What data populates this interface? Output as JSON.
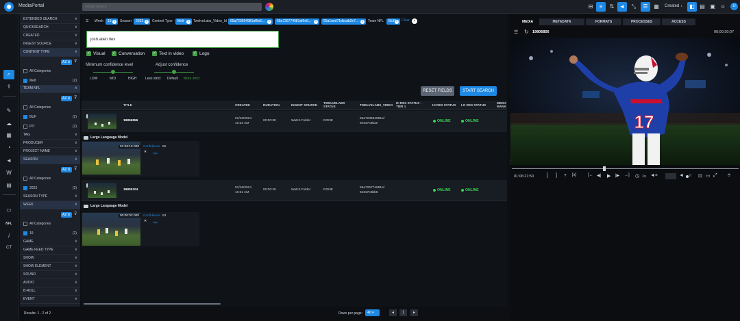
{
  "app": {
    "title": "MediaPortal",
    "search_placeholder": "Global Search",
    "sort_label": "Created",
    "avatar_letter": "U"
  },
  "filters": {
    "rows": [
      {
        "label": "EXTENDED SEARCH",
        "chev": "∨"
      },
      {
        "label": "QUICKSEARCH",
        "chev": "∨"
      },
      {
        "label": "CREATED",
        "chev": "∨"
      },
      {
        "label": "INGEST SOURCE",
        "chev": "∨"
      },
      {
        "label": "CONTENT TYPE",
        "chev": "∧"
      }
    ],
    "content_type": {
      "sort": "AZ ⬇",
      "all": "All Categories",
      "item": "Melt",
      "count": "(2)"
    },
    "team_nfl": {
      "label": "TEAM NFL",
      "sort": "AZ ⬇",
      "all": "All Categories",
      "items": [
        {
          "label": "BUF",
          "count": "(2)"
        },
        {
          "label": "PIT",
          "count": "(2)"
        }
      ]
    },
    "rows2": [
      {
        "label": "TAG",
        "chev": "∨"
      },
      {
        "label": "PRODUCER",
        "chev": "∨"
      },
      {
        "label": "PROJECT NAME",
        "chev": "∨"
      },
      {
        "label": "SEASON",
        "chev": "∧"
      }
    ],
    "season": {
      "sort": "AZ ⬇",
      "all": "All Categories",
      "item": "2023",
      "count": "(2)"
    },
    "rows3": [
      {
        "label": "SEASON TYPE",
        "chev": "∨"
      },
      {
        "label": "WEEK",
        "chev": "∧"
      }
    ],
    "week": {
      "sort": "AZ ⬇",
      "all": "All Categories",
      "item": "19",
      "count": "(2)"
    },
    "rows4": [
      {
        "label": "GAME",
        "chev": "∨"
      },
      {
        "label": "GAME FEED TYPE",
        "chev": "∨"
      },
      {
        "label": "SHOW",
        "chev": "∨"
      },
      {
        "label": "SHOW ELEMENT",
        "chev": "∨"
      },
      {
        "label": "SOUND",
        "chev": "∨"
      },
      {
        "label": "AUDIO",
        "chev": "∨"
      },
      {
        "label": "B-ROLL",
        "chev": "∨"
      },
      {
        "label": "EVENT",
        "chev": "∨"
      }
    ],
    "results": "Results: 1 - 2 of 2"
  },
  "chips": [
    {
      "label": "Week",
      "value": "19"
    },
    {
      "label": "Season",
      "value": "2023"
    },
    {
      "label": "Content Type",
      "value": "Melt"
    },
    {
      "label": "TwelveLabs_Video_Id",
      "value": "65a723664981af6e6..."
    },
    {
      "label": "",
      "value": "65a726774981af6e6..."
    },
    {
      "label": "",
      "value": "65a1aed71dbcab2e7..."
    },
    {
      "label": "Team NFL",
      "value": "BUF"
    }
  ],
  "clear_label": "Clear",
  "query": "josh allen flex",
  "modalities": [
    "Visual",
    "Conversation",
    "Text in video",
    "Logo"
  ],
  "confidence": {
    "min_label": "Minimum confidence level",
    "min_ticks": [
      "LOW",
      "MID",
      "HIGH"
    ],
    "adj_label": "Adjust confidence",
    "adj_ticks": [
      "Less strict",
      "Default",
      "More strict"
    ]
  },
  "buttons": {
    "reset": "RESET FIELDS",
    "start": "START SEARCH"
  },
  "table": {
    "headers": [
      "TITLE",
      "CREATED",
      "DURATION",
      "INGEST SOURCE",
      "TWELVELABS STATUS",
      "TWELVELABS_VIDEO_ID",
      "HI RES STATUS - TIER 1",
      "HI RES STATUS",
      "LO RES STATUS",
      "MEDIA MANA"
    ],
    "rows": [
      {
        "title": "19806856",
        "created1": "01/16/2024",
        "created2": "10:32 AM",
        "duration": "00:00:30",
        "ingest": "Watch Folder",
        "tl_status": "DONE",
        "vid1": "65a723664981af",
        "vid2": "6e637c8bae",
        "hi": "ONLINE",
        "lo": "ONLINE",
        "llm": {
          "header": "Large Language Model",
          "timecode": "01:06:15.000",
          "conf_label": "Confidence",
          "conf_value": "85",
          "level": "high"
        }
      },
      {
        "title": "19805104",
        "created1": "01/16/2024",
        "created2": "10:31 AM",
        "duration": "00:00:29",
        "ingest": "Watch Folder",
        "tl_status": "DONE",
        "vid1": "65a726774981af",
        "vid2": "6e637c8bb5",
        "hi": "ONLINE",
        "lo": "ONLINE",
        "llm": {
          "header": "Large Language Model",
          "timecode": "00:00:02.000",
          "conf_label": "Confidence",
          "conf_value": "83",
          "level": "high"
        }
      }
    ]
  },
  "pager": {
    "label": "Rows per page:",
    "per_page": "40",
    "page": "1"
  },
  "right": {
    "tabs": [
      "MEDIA",
      "METADATA",
      "FORMATS",
      "PROCESSES",
      "ACCESS"
    ],
    "asset_id": "19806856",
    "timecode_top": "00;00;30;07",
    "jersey_number": "17",
    "current_time": "01:06:21:50",
    "speed": "1x"
  },
  "colors": {
    "accent": "#1e88e5",
    "online": "#39d353",
    "check": "#43a047"
  }
}
